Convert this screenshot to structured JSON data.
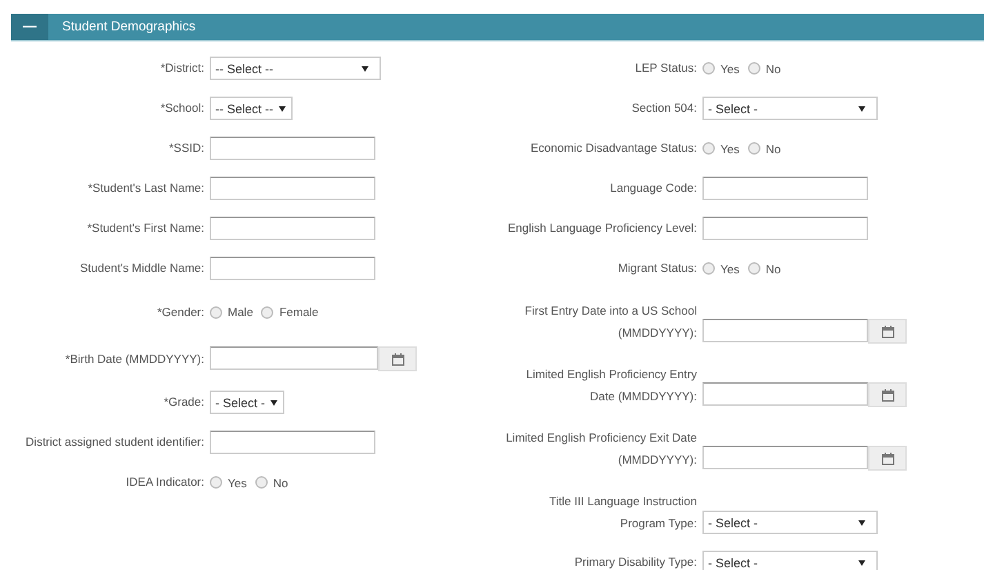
{
  "panel": {
    "toggle": "—",
    "title": "Student Demographics"
  },
  "left_fields": [
    {
      "label": "*District:",
      "kind": "select",
      "value": "-- Select --"
    },
    {
      "label": "*School:",
      "kind": "shortselect",
      "value": "-- Select --"
    },
    {
      "label": "*SSID:",
      "kind": "text"
    },
    {
      "label": "*Student's Last Name:",
      "kind": "text"
    },
    {
      "label": "*Student's First Name:",
      "kind": "text"
    },
    {
      "label": "Student's Middle Name:",
      "kind": "text"
    },
    {
      "label": "*Gender:",
      "kind": "radio",
      "options": [
        {
          "label": "Male",
          "selected": false
        },
        {
          "label": "Female",
          "selected": false
        }
      ]
    },
    {
      "label": "*Birth Date (MMDDYYYY):",
      "kind": "date"
    },
    {
      "label": "*Grade:",
      "kind": "shortselect",
      "value": "- Select -"
    },
    {
      "label": "District assigned student identifier:",
      "kind": "text"
    },
    {
      "label": "IDEA Indicator:",
      "kind": "radio",
      "options": [
        {
          "label": "Yes",
          "selected": false
        },
        {
          "label": "No",
          "selected": false
        }
      ]
    }
  ],
  "right_fields": [
    {
      "label": "LEP Status:",
      "kind": "radio",
      "options": [
        {
          "label": "Yes",
          "selected": false
        },
        {
          "label": "No",
          "selected": false
        }
      ]
    },
    {
      "label": "Section 504:",
      "kind": "select",
      "value": "- Select -"
    },
    {
      "label": "Economic Disadvantage Status:",
      "kind": "radio",
      "options": [
        {
          "label": "Yes",
          "selected": false
        },
        {
          "label": "No",
          "selected": false
        }
      ]
    },
    {
      "label": "Language Code:",
      "kind": "text"
    },
    {
      "label": "English Language Proficiency Level:",
      "kind": "text"
    },
    {
      "label": "Migrant Status:",
      "kind": "radio",
      "options": [
        {
          "label": "Yes",
          "selected": false
        },
        {
          "label": "No",
          "selected": false
        }
      ]
    },
    {
      "label": "First Entry Date into a US School\n(MMDDYYYY):",
      "kind": "date"
    },
    {
      "label": "Limited English Proficiency Entry\nDate (MMDDYYYY):",
      "kind": "date"
    },
    {
      "label": "Limited English Proficiency Exit Date\n(MMDDYYYY):",
      "kind": "date"
    },
    {
      "label": "Title III Language Instruction\nProgram Type:",
      "kind": "select",
      "value": "- Select -"
    },
    {
      "label": "Primary Disability Type:",
      "kind": "select",
      "value": "- Select -"
    }
  ]
}
